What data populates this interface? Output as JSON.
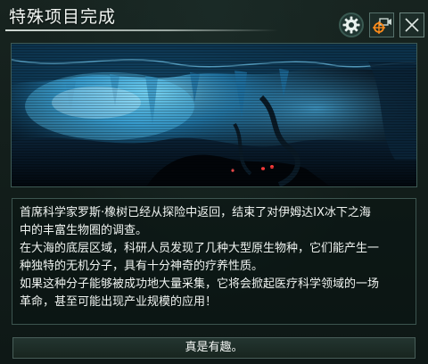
{
  "window": {
    "title": "特殊项目完成"
  },
  "toolbar": {
    "settings_icon": "gear-icon",
    "camera_icon": "camera-locate-icon",
    "close_icon": "close-icon"
  },
  "illustration": {
    "icon": "ice-cave-scene"
  },
  "message": {
    "paragraphs": [
      [
        "首席科学家罗斯·橡树已经从探险中返回，结束了对伊姆达IX冰下之海",
        "中的丰富生物圈的调查。"
      ],
      [
        "在大海的底层区域，科研人员发现了几种大型原生物种，它们能产生一",
        "种独特的无机分子，具有十分神奇的疗养性质。"
      ],
      [
        "如果这种分子能够被成功地大量采集，它将会掀起医疗科学领域的一场",
        "革命，甚至可能出现产业规模的应用！"
      ]
    ]
  },
  "actions": {
    "confirm_label": "真是有趣。"
  },
  "colors": {
    "accent": "#ff8c1a",
    "panel_bg": "#14211e",
    "border": "#3e5b56",
    "ice_glow": "#39c8ff"
  }
}
